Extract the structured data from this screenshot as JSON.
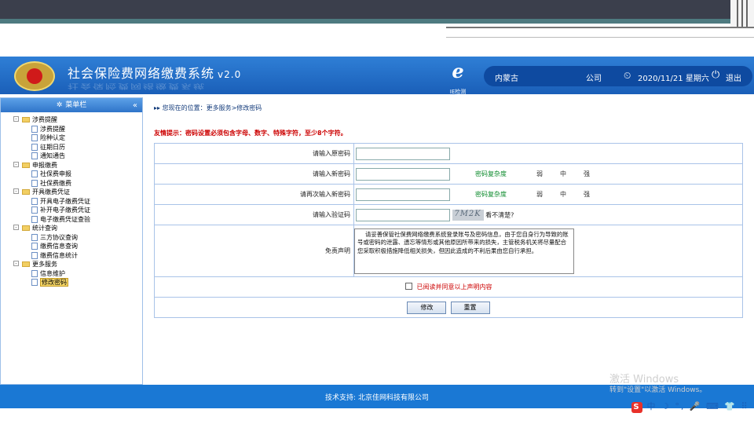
{
  "header": {
    "title": "社会保险费网络缴费系统",
    "version": "v2.0",
    "ie_label": "IE检测",
    "region": "内蒙古",
    "company": "公司",
    "datetime": "2020/11/21 星期六",
    "logout": "退出"
  },
  "sidebar": {
    "title": "菜单栏",
    "groups": [
      {
        "label": "涉费提醒",
        "items": [
          "涉费提醒",
          "险种认定",
          "征期日历",
          "通知通告"
        ]
      },
      {
        "label": "申报缴费",
        "items": [
          "社保费申报",
          "社保费缴费"
        ]
      },
      {
        "label": "开具缴费凭证",
        "items": [
          "开具电子缴费凭证",
          "补开电子缴费凭证",
          "电子缴费凭证查验"
        ]
      },
      {
        "label": "统计查询",
        "items": [
          "三方协议查询",
          "缴费信息查询",
          "缴费信息统计"
        ]
      },
      {
        "label": "更多服务",
        "items": [
          "信息维护",
          "修改密码"
        ]
      }
    ],
    "selected": "修改密码"
  },
  "main": {
    "breadcrumb": "您现在的位置：更多服务>修改密码",
    "tip": "友情提示：密码设置必须包含字母、数字、特殊字符，至少8个字符。",
    "fields": {
      "old_password": "请输入原密码",
      "new_password": "请输入新密码",
      "confirm_password": "请再次输入新密码",
      "captcha": "请输入验证码",
      "disclaimer_label": "免责声明"
    },
    "strength_label": "密码复杂度",
    "strength_levels": [
      "弱",
      "中",
      "强"
    ],
    "captcha_text": "7M2K",
    "captcha_unclear": "看不清楚?",
    "disclaimer_text": "请妥善保管社保费网络缴费系统登录账号及密码信息，由于您自身行为导致的账号或密码的泄露、遗忘等情形或其他原因所带来的损失，主管税务机关将尽量配合您采取积极措施降低相关损失，但因此造成的不利后果由您自行承担。",
    "agree_text": "已阅读并同意以上声明内容",
    "buttons": {
      "submit": "修改",
      "reset": "重置"
    }
  },
  "footer": {
    "support": "技术支持: 北京佳网科技有限公司"
  },
  "watermark": {
    "line1": "激活 Windows",
    "line2": "转到\"设置\"以激活 Windows。"
  },
  "ime": {
    "text": "中 ☽ °, 🎤 ⌨ 👕 ⠿"
  }
}
